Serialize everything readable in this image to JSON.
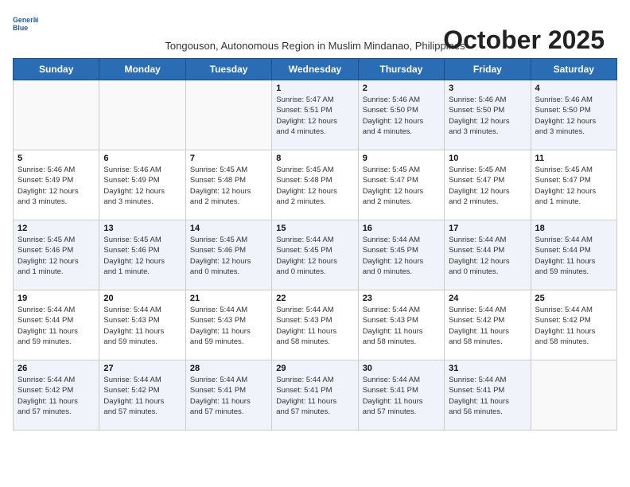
{
  "logo": {
    "line1": "General",
    "line2": "Blue"
  },
  "title": "October 2025",
  "subtitle": "Tongouson, Autonomous Region in Muslim Mindanao, Philippines",
  "days_of_week": [
    "Sunday",
    "Monday",
    "Tuesday",
    "Wednesday",
    "Thursday",
    "Friday",
    "Saturday"
  ],
  "weeks": [
    [
      {
        "day": "",
        "info": ""
      },
      {
        "day": "",
        "info": ""
      },
      {
        "day": "",
        "info": ""
      },
      {
        "day": "1",
        "info": "Sunrise: 5:47 AM\nSunset: 5:51 PM\nDaylight: 12 hours\nand 4 minutes."
      },
      {
        "day": "2",
        "info": "Sunrise: 5:46 AM\nSunset: 5:50 PM\nDaylight: 12 hours\nand 4 minutes."
      },
      {
        "day": "3",
        "info": "Sunrise: 5:46 AM\nSunset: 5:50 PM\nDaylight: 12 hours\nand 3 minutes."
      },
      {
        "day": "4",
        "info": "Sunrise: 5:46 AM\nSunset: 5:50 PM\nDaylight: 12 hours\nand 3 minutes."
      }
    ],
    [
      {
        "day": "5",
        "info": "Sunrise: 5:46 AM\nSunset: 5:49 PM\nDaylight: 12 hours\nand 3 minutes."
      },
      {
        "day": "6",
        "info": "Sunrise: 5:46 AM\nSunset: 5:49 PM\nDaylight: 12 hours\nand 3 minutes."
      },
      {
        "day": "7",
        "info": "Sunrise: 5:45 AM\nSunset: 5:48 PM\nDaylight: 12 hours\nand 2 minutes."
      },
      {
        "day": "8",
        "info": "Sunrise: 5:45 AM\nSunset: 5:48 PM\nDaylight: 12 hours\nand 2 minutes."
      },
      {
        "day": "9",
        "info": "Sunrise: 5:45 AM\nSunset: 5:47 PM\nDaylight: 12 hours\nand 2 minutes."
      },
      {
        "day": "10",
        "info": "Sunrise: 5:45 AM\nSunset: 5:47 PM\nDaylight: 12 hours\nand 2 minutes."
      },
      {
        "day": "11",
        "info": "Sunrise: 5:45 AM\nSunset: 5:47 PM\nDaylight: 12 hours\nand 1 minute."
      }
    ],
    [
      {
        "day": "12",
        "info": "Sunrise: 5:45 AM\nSunset: 5:46 PM\nDaylight: 12 hours\nand 1 minute."
      },
      {
        "day": "13",
        "info": "Sunrise: 5:45 AM\nSunset: 5:46 PM\nDaylight: 12 hours\nand 1 minute."
      },
      {
        "day": "14",
        "info": "Sunrise: 5:45 AM\nSunset: 5:46 PM\nDaylight: 12 hours\nand 0 minutes."
      },
      {
        "day": "15",
        "info": "Sunrise: 5:44 AM\nSunset: 5:45 PM\nDaylight: 12 hours\nand 0 minutes."
      },
      {
        "day": "16",
        "info": "Sunrise: 5:44 AM\nSunset: 5:45 PM\nDaylight: 12 hours\nand 0 minutes."
      },
      {
        "day": "17",
        "info": "Sunrise: 5:44 AM\nSunset: 5:44 PM\nDaylight: 12 hours\nand 0 minutes."
      },
      {
        "day": "18",
        "info": "Sunrise: 5:44 AM\nSunset: 5:44 PM\nDaylight: 11 hours\nand 59 minutes."
      }
    ],
    [
      {
        "day": "19",
        "info": "Sunrise: 5:44 AM\nSunset: 5:44 PM\nDaylight: 11 hours\nand 59 minutes."
      },
      {
        "day": "20",
        "info": "Sunrise: 5:44 AM\nSunset: 5:43 PM\nDaylight: 11 hours\nand 59 minutes."
      },
      {
        "day": "21",
        "info": "Sunrise: 5:44 AM\nSunset: 5:43 PM\nDaylight: 11 hours\nand 59 minutes."
      },
      {
        "day": "22",
        "info": "Sunrise: 5:44 AM\nSunset: 5:43 PM\nDaylight: 11 hours\nand 58 minutes."
      },
      {
        "day": "23",
        "info": "Sunrise: 5:44 AM\nSunset: 5:43 PM\nDaylight: 11 hours\nand 58 minutes."
      },
      {
        "day": "24",
        "info": "Sunrise: 5:44 AM\nSunset: 5:42 PM\nDaylight: 11 hours\nand 58 minutes."
      },
      {
        "day": "25",
        "info": "Sunrise: 5:44 AM\nSunset: 5:42 PM\nDaylight: 11 hours\nand 58 minutes."
      }
    ],
    [
      {
        "day": "26",
        "info": "Sunrise: 5:44 AM\nSunset: 5:42 PM\nDaylight: 11 hours\nand 57 minutes."
      },
      {
        "day": "27",
        "info": "Sunrise: 5:44 AM\nSunset: 5:42 PM\nDaylight: 11 hours\nand 57 minutes."
      },
      {
        "day": "28",
        "info": "Sunrise: 5:44 AM\nSunset: 5:41 PM\nDaylight: 11 hours\nand 57 minutes."
      },
      {
        "day": "29",
        "info": "Sunrise: 5:44 AM\nSunset: 5:41 PM\nDaylight: 11 hours\nand 57 minutes."
      },
      {
        "day": "30",
        "info": "Sunrise: 5:44 AM\nSunset: 5:41 PM\nDaylight: 11 hours\nand 57 minutes."
      },
      {
        "day": "31",
        "info": "Sunrise: 5:44 AM\nSunset: 5:41 PM\nDaylight: 11 hours\nand 56 minutes."
      },
      {
        "day": "",
        "info": ""
      }
    ]
  ]
}
